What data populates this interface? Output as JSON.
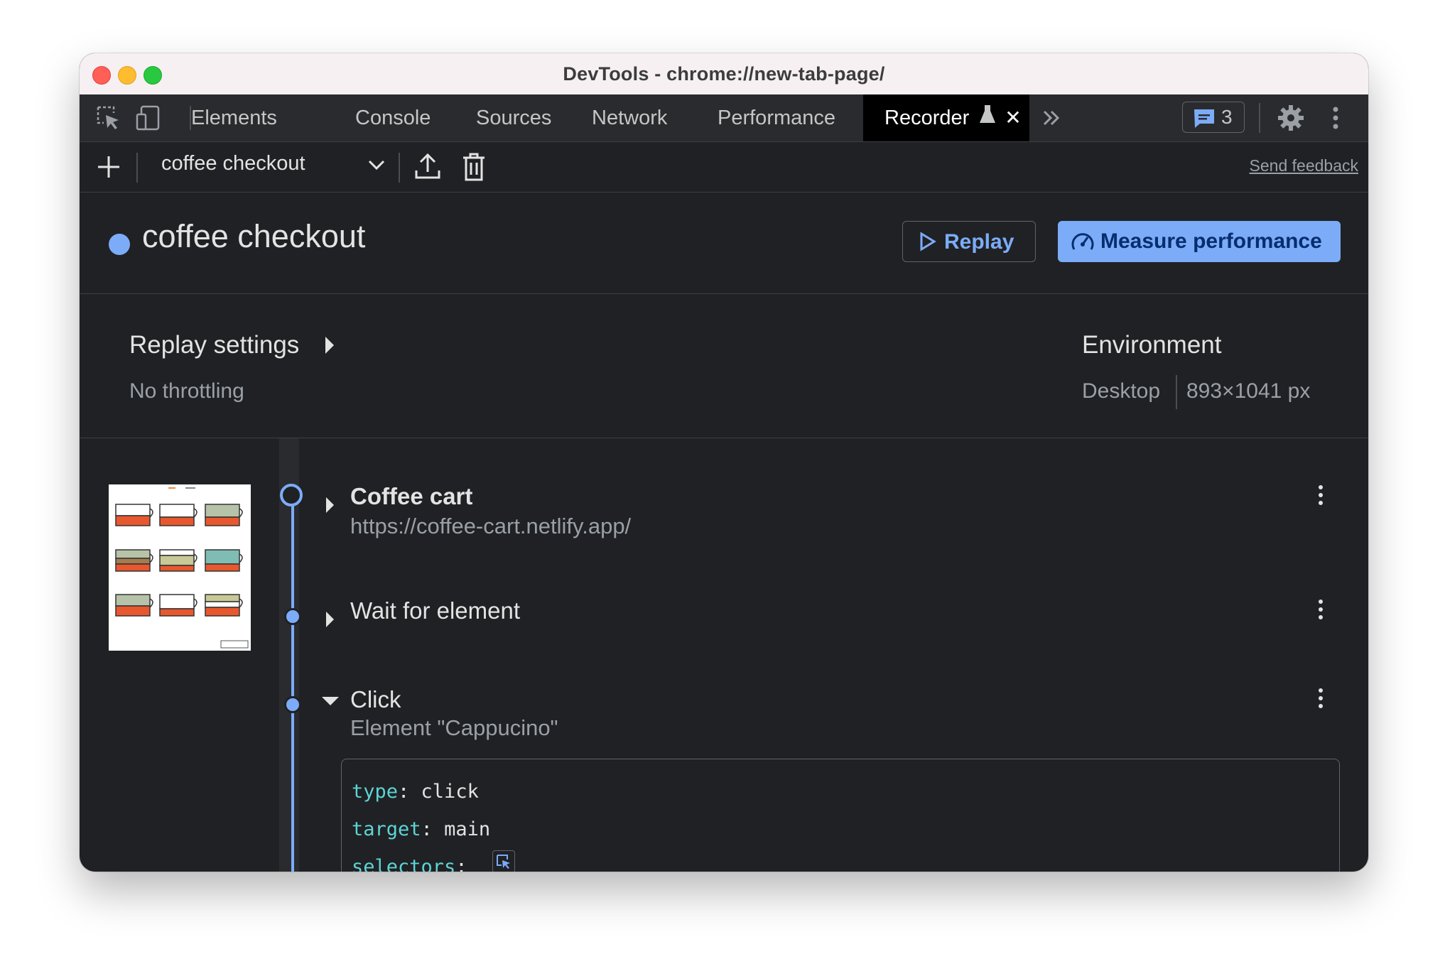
{
  "window": {
    "title": "DevTools - chrome://new-tab-page/"
  },
  "tabs": [
    {
      "label": "Elements"
    },
    {
      "label": "Console"
    },
    {
      "label": "Sources"
    },
    {
      "label": "Network"
    },
    {
      "label": "Performance"
    },
    {
      "label": "Recorder",
      "active": true
    }
  ],
  "issues_badge": {
    "count": "3"
  },
  "toolbar": {
    "selected_recording": "coffee checkout",
    "send_feedback": "Send feedback"
  },
  "recording": {
    "title": "coffee checkout",
    "replay_label": "Replay",
    "measure_label": "Measure performance"
  },
  "replay_settings": {
    "title": "Replay settings",
    "throttling": "No throttling",
    "environment_title": "Environment",
    "device": "Desktop",
    "viewport": "893×1041 px"
  },
  "steps": [
    {
      "title": "Coffee cart",
      "subtitle": "https://coffee-cart.netlify.app/"
    },
    {
      "title": "Wait for element"
    },
    {
      "title": "Click",
      "subtitle": "Element \"Cappucino\""
    }
  ],
  "code": {
    "type_key": "type",
    "type_value": "click",
    "target_key": "target",
    "target_value": "main",
    "selectors_key": "selectors"
  },
  "colors": {
    "accent": "#7cacf8",
    "background": "#202124",
    "code_key": "#5cd5d5"
  }
}
